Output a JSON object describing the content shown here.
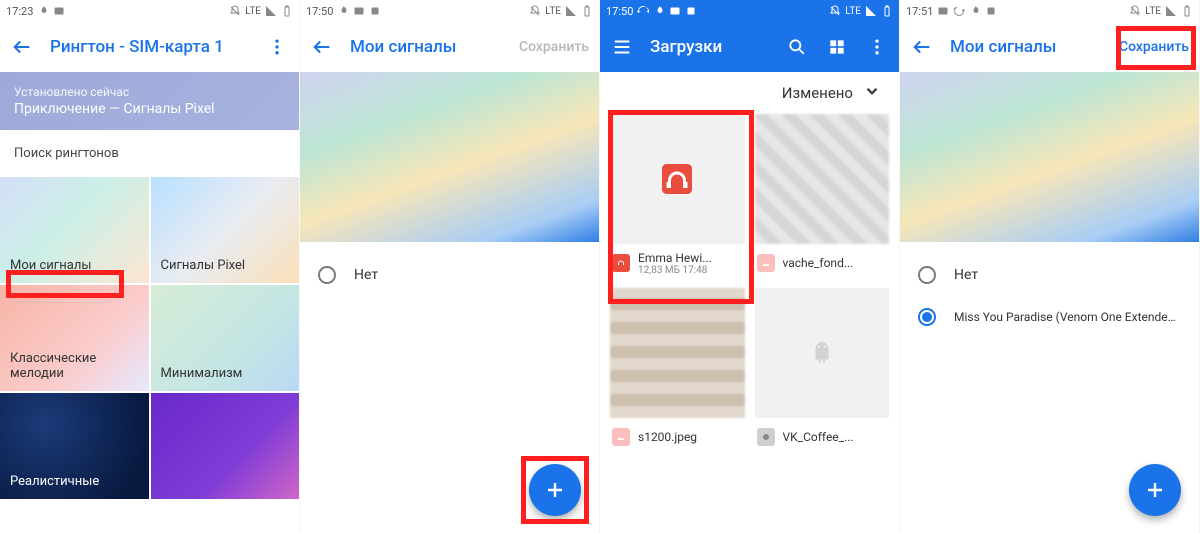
{
  "screens": [
    {
      "status": {
        "time": "17:23",
        "net": "LTE"
      },
      "appbar": {
        "title": "Рингтон - SIM-карта 1"
      },
      "banner": {
        "line1": "Установлено сейчас",
        "line2": "Приключение — Сигналы Pixel"
      },
      "search_label": "Поиск рингтонов",
      "categories": [
        {
          "label": "Мои сигналы"
        },
        {
          "label": "Сигналы Pixel"
        },
        {
          "label": "Классические мелодии"
        },
        {
          "label": "Минимализм"
        },
        {
          "label": "Реалистичные"
        },
        {
          "label": ""
        }
      ]
    },
    {
      "status": {
        "time": "17:50",
        "net": "LTE"
      },
      "appbar": {
        "title": "Мои сигналы",
        "action": "Сохранить",
        "action_enabled": false
      },
      "options": [
        {
          "label": "Нет",
          "selected": false
        }
      ]
    },
    {
      "status": {
        "time": "17:50",
        "net": "LTE"
      },
      "appbar": {
        "title": "Загрузки"
      },
      "sort": "Изменено",
      "files": [
        {
          "name": "Emma Hewi...",
          "sub": "12,83 МБ 17:48",
          "kind": "audio"
        },
        {
          "name": "vache_fond...",
          "sub": "",
          "kind": "image"
        },
        {
          "name": "s1200.jpeg",
          "sub": "",
          "kind": "image"
        },
        {
          "name": "VK_Coffee_...",
          "sub": "",
          "kind": "apk"
        }
      ]
    },
    {
      "status": {
        "time": "17:51",
        "net": "LTE"
      },
      "appbar": {
        "title": "Мои сигналы",
        "action": "Сохранить",
        "action_enabled": true
      },
      "options": [
        {
          "label": "Нет",
          "selected": false
        },
        {
          "label": "Miss You Paradise (Venom One Extended Mix)",
          "selected": true
        }
      ]
    }
  ]
}
